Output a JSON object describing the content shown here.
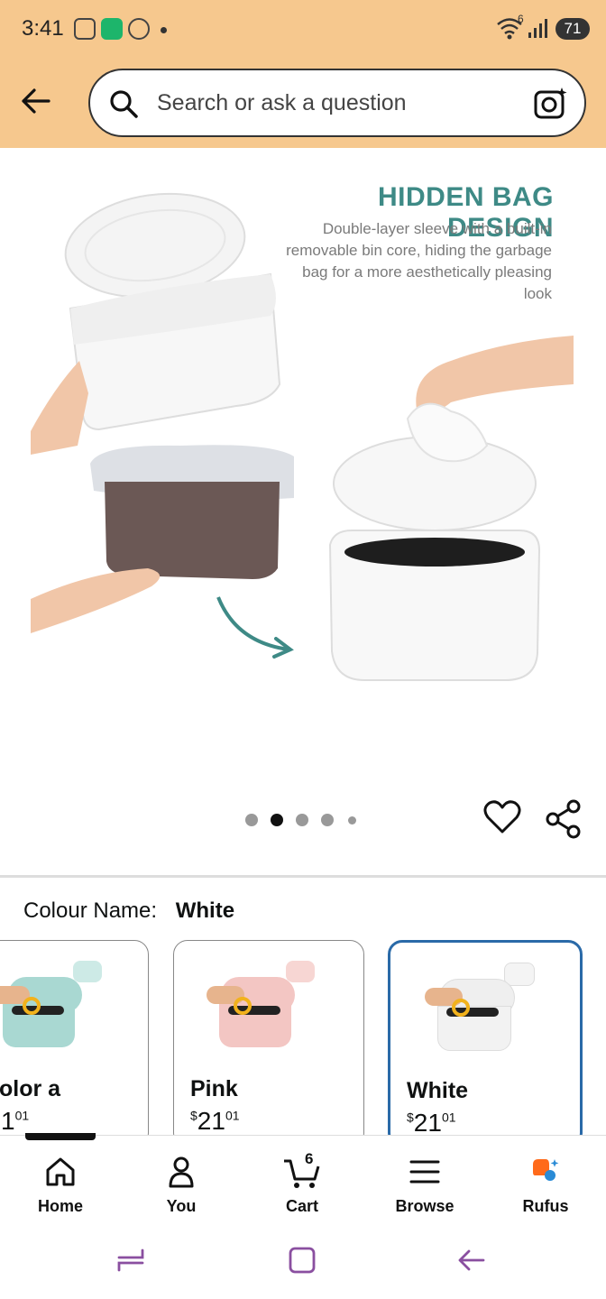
{
  "status_bar": {
    "time": "3:41",
    "battery": "71",
    "signal_badge": "6"
  },
  "search": {
    "placeholder": "Search or ask a question"
  },
  "hero": {
    "title": "HIDDEN BAG DESIGN",
    "description": "Double-layer sleeve with a built-in removable bin core, hiding the garbage bag for a more aesthetically pleasing look",
    "image_count": 5,
    "active_image": 2
  },
  "variant": {
    "label": "Colour Name:",
    "selected": "White",
    "options": [
      {
        "name": "Color a",
        "shown_name": "olor a",
        "price_whole": "1",
        "price_cents": "01",
        "color": "#a9d8d2"
      },
      {
        "name": "Pink",
        "shown_name": "Pink",
        "price_whole": "21",
        "price_cents": "01",
        "color": "#f3c6c3"
      },
      {
        "name": "White",
        "shown_name": "White",
        "price_whole": "21",
        "price_cents": "01",
        "color": "#eeeeee"
      }
    ],
    "currency_symbol": "$"
  },
  "bottom_nav": {
    "items": [
      {
        "label": "Home"
      },
      {
        "label": "You"
      },
      {
        "label": "Cart"
      },
      {
        "label": "Browse"
      },
      {
        "label": "Rufus"
      }
    ],
    "cart_count": "6"
  },
  "colors": {
    "header_bg": "#f6c88e",
    "accent_teal": "#3e8a86",
    "selected_border": "#2a6aa8",
    "system_nav": "#8a4fa0"
  }
}
